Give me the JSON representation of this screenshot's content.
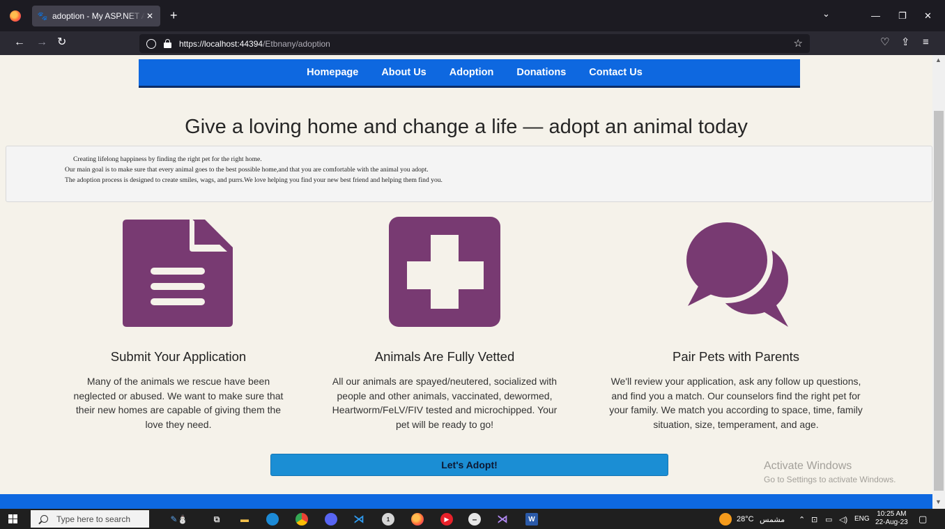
{
  "browser": {
    "tab_title": "adoption - My ASP.NET Applic",
    "tab_close": "✕",
    "new_tab": "+",
    "url_host": "https://localhost:44394",
    "url_path": "/Etbnany/adoption",
    "minimize": "—",
    "restore": "❐",
    "close": "✕",
    "dropdown": "⌄"
  },
  "site_nav": {
    "items": [
      "Homepage",
      "About Us",
      "Adoption",
      "Donations",
      "Contact Us"
    ]
  },
  "headline": "Give a loving home and change a life — adopt an animal today",
  "intro": {
    "line1": "Creating lifelong happiness by finding the right pet for the right home.",
    "line2": "Our main goal is to make sure that every animal goes to the best possible home,and that you are comfortable with the animal you adopt.",
    "line3": "The adoption process is designed to create smiles, wags, and purrs.We love helping you find your new best friend and helping them find you."
  },
  "features": [
    {
      "title": "Submit Your Application",
      "text": "Many of the animals we rescue have been neglected or abused. We want to make sure that their new homes are capable of giving them the love they need.",
      "icon": "document-icon"
    },
    {
      "title": "Animals Are Fully Vetted",
      "text": "All our animals are spayed/neutered, socialized with people and other animals, vaccinated, dewormed, Heartworm/FeLV/FIV tested and microchipped. Your pet will be ready to go!",
      "icon": "medical-cross-icon"
    },
    {
      "title": "Pair Pets with Parents",
      "text": "We'll review your application, ask any follow up questions, and find you a match. Our counselors find the right pet for your family. We match you according to space, time, family situation, size, temperament, and age.",
      "icon": "chat-bubbles-icon"
    }
  ],
  "adopt_button": "Let's Adopt!",
  "watermark": {
    "line1": "Activate Windows",
    "line2": "Go to Settings to activate Windows."
  },
  "taskbar": {
    "search_placeholder": "Type here to search",
    "weather": "28°C",
    "weather_text": "مشمس",
    "language": "ENG",
    "time": "10:25 AM",
    "date": "22-Aug-23",
    "whatsapp_badge": "1"
  },
  "colors": {
    "accent": "#0e68e0",
    "icon_purple": "#783a72",
    "button_blue": "#1b8ed4",
    "page_bg": "#f5f2ea"
  }
}
